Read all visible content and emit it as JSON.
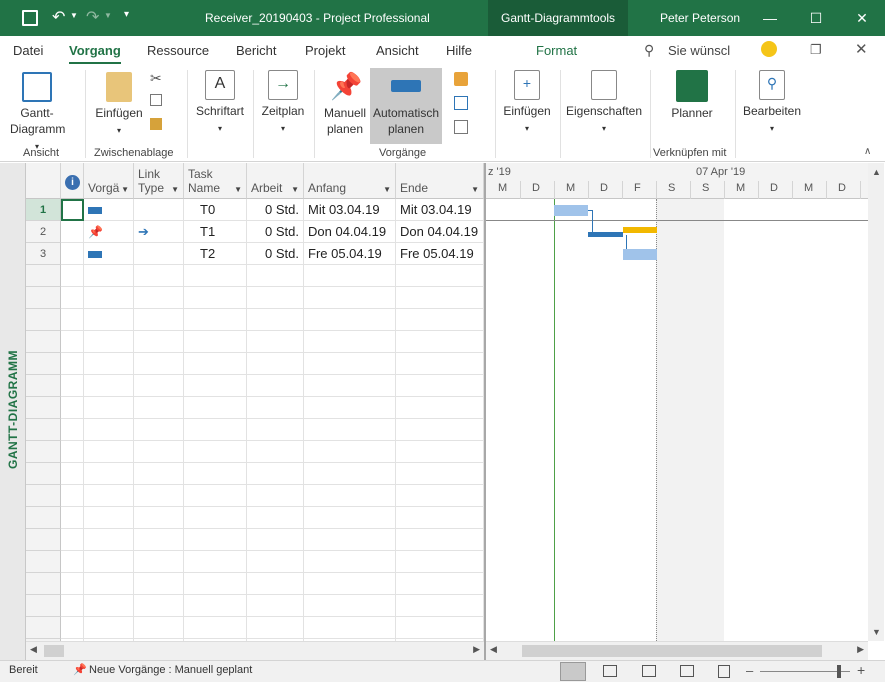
{
  "title": {
    "filename": "Receiver_20190403",
    "separator": " - ",
    "app": "Project Professional",
    "context_tab": "Gantt-Diagrammtools",
    "user": "Peter Peterson"
  },
  "menu": [
    "Datei",
    "Vorgang",
    "Ressource",
    "Bericht",
    "Projekt",
    "Ansicht",
    "Hilfe",
    "Format"
  ],
  "search_placeholder": "Sie wünscl",
  "ribbon": {
    "gantt_btn_line1": "Gantt-",
    "gantt_btn_line2": "Diagramm",
    "group_ansicht": "Ansicht",
    "paste_btn": "Einfügen",
    "group_clipboard": "Zwischenablage",
    "font_btn": "Schriftart",
    "schedule_btn": "Zeitplan",
    "manual_line1": "Manuell",
    "manual_line2": "planen",
    "auto_line1": "Automatisch",
    "auto_line2": "planen",
    "group_tasks": "Vorgänge",
    "insert_btn": "Einfügen",
    "props_btn": "Eigenschaften",
    "planner_btn": "Planner",
    "group_link": "Verknüpfen mit",
    "edit_btn": "Bearbeiten"
  },
  "sidebar_label": "GANTT-DIAGRAMM",
  "columns": {
    "mode": "Vorgä",
    "link_line1": "Link",
    "link_line2": "Type",
    "name_line1": "Task",
    "name_line2": "Name",
    "work": "Arbeit",
    "start": "Anfang",
    "end": "Ende"
  },
  "rows": [
    {
      "id": "1",
      "name": "T0",
      "work": "0 Std.",
      "start": "Mit 03.04.19",
      "end": "Mit 03.04.19"
    },
    {
      "id": "2",
      "name": "T1",
      "work": "0 Std.",
      "start": "Don 04.04.19",
      "end": "Don 04.04.19"
    },
    {
      "id": "3",
      "name": "T2",
      "work": "0 Std.",
      "start": "Fre 05.04.19",
      "end": "Fre 05.04.19"
    }
  ],
  "gantt": {
    "week1": "z '19",
    "week2": "07 Apr '19",
    "days": [
      "M",
      "D",
      "M",
      "D",
      "F",
      "S",
      "S",
      "M",
      "D",
      "M",
      "D"
    ]
  },
  "status": {
    "ready": "Bereit",
    "new_tasks": "Neue Vorgänge : Manuell geplant"
  },
  "colors": {
    "accent": "#217346",
    "bar": "#a0c3ea",
    "critical": "#f2b800",
    "link": "#2e75b6"
  }
}
